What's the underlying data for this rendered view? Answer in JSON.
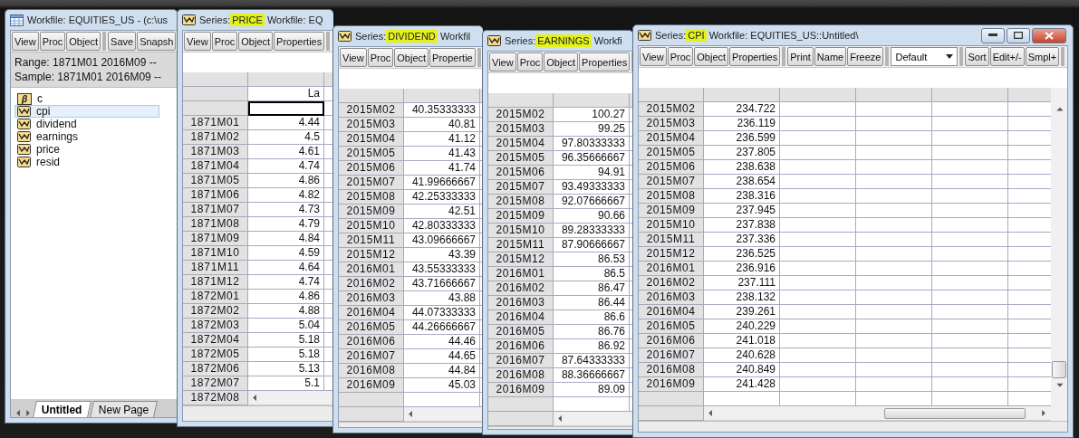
{
  "workfile_window": {
    "title": "Workfile: EQUITIES_US - (c:\\us",
    "toolbar": [
      [
        {
          "label": "View",
          "kind": "button"
        },
        {
          "label": "Proc",
          "kind": "button"
        },
        {
          "label": "Object",
          "kind": "button"
        }
      ],
      [
        {
          "label": "Save",
          "kind": "button"
        },
        {
          "label": "Snapsh",
          "kind": "button"
        }
      ]
    ],
    "range": "Range:  1871M01 2016M09  --",
    "sample": "Sample: 1871M01 2016M09  --",
    "objects": [
      {
        "name": "c",
        "kind": "coefficient",
        "glyph": "β",
        "selected": false
      },
      {
        "name": "cpi",
        "kind": "series",
        "selected": true
      },
      {
        "name": "dividend",
        "kind": "series",
        "selected": false
      },
      {
        "name": "earnings",
        "kind": "series",
        "selected": false
      },
      {
        "name": "price",
        "kind": "series",
        "selected": false
      },
      {
        "name": "resid",
        "kind": "series",
        "selected": false
      }
    ],
    "page_tabs": [
      {
        "label": "Untitled",
        "selected": true
      },
      {
        "label": "New Page",
        "selected": false
      }
    ]
  },
  "series_windows": [
    {
      "prefix": "Series:",
      "name": "PRICE",
      "highlighted": true,
      "suffix": "Workfile: EQ",
      "edit_row": true,
      "column_label": "La",
      "scroll_row_label": "1872M08",
      "toolbar": [
        [
          {
            "label": "View",
            "kind": "button"
          },
          {
            "label": "Proc",
            "kind": "button"
          },
          {
            "label": "Object",
            "kind": "button"
          },
          {
            "label": "Properties",
            "kind": "button"
          }
        ]
      ],
      "rows": [
        {
          "date": "1871M01",
          "value": "4.44"
        },
        {
          "date": "1871M02",
          "value": "4.5"
        },
        {
          "date": "1871M03",
          "value": "4.61"
        },
        {
          "date": "1871M04",
          "value": "4.74"
        },
        {
          "date": "1871M05",
          "value": "4.86"
        },
        {
          "date": "1871M06",
          "value": "4.82"
        },
        {
          "date": "1871M07",
          "value": "4.73"
        },
        {
          "date": "1871M08",
          "value": "4.79"
        },
        {
          "date": "1871M09",
          "value": "4.84"
        },
        {
          "date": "1871M10",
          "value": "4.59"
        },
        {
          "date": "1871M11",
          "value": "4.64"
        },
        {
          "date": "1871M12",
          "value": "4.74"
        },
        {
          "date": "1872M01",
          "value": "4.86"
        },
        {
          "date": "1872M02",
          "value": "4.88"
        },
        {
          "date": "1872M03",
          "value": "5.04"
        },
        {
          "date": "1872M04",
          "value": "5.18"
        },
        {
          "date": "1872M05",
          "value": "5.18"
        },
        {
          "date": "1872M06",
          "value": "5.13"
        },
        {
          "date": "1872M07",
          "value": "5.1"
        }
      ]
    },
    {
      "prefix": "Series:",
      "name": "DIVIDEND",
      "highlighted": true,
      "suffix": "Workfil",
      "edit_row": false,
      "toolbar": [
        [
          {
            "label": "View",
            "kind": "button"
          },
          {
            "label": "Proc",
            "kind": "button"
          },
          {
            "label": "Object",
            "kind": "button"
          },
          {
            "label": "Propertie",
            "kind": "button"
          }
        ]
      ],
      "rows": [
        {
          "date": "2015M02",
          "value": "40.35333333"
        },
        {
          "date": "2015M03",
          "value": "40.81"
        },
        {
          "date": "2015M04",
          "value": "41.12"
        },
        {
          "date": "2015M05",
          "value": "41.43"
        },
        {
          "date": "2015M06",
          "value": "41.74"
        },
        {
          "date": "2015M07",
          "value": "41.99666667"
        },
        {
          "date": "2015M08",
          "value": "42.25333333"
        },
        {
          "date": "2015M09",
          "value": "42.51"
        },
        {
          "date": "2015M10",
          "value": "42.80333333"
        },
        {
          "date": "2015M11",
          "value": "43.09666667"
        },
        {
          "date": "2015M12",
          "value": "43.39"
        },
        {
          "date": "2016M01",
          "value": "43.55333333"
        },
        {
          "date": "2016M02",
          "value": "43.71666667"
        },
        {
          "date": "2016M03",
          "value": "43.88"
        },
        {
          "date": "2016M04",
          "value": "44.07333333"
        },
        {
          "date": "2016M05",
          "value": "44.26666667"
        },
        {
          "date": "2016M06",
          "value": "44.46"
        },
        {
          "date": "2016M07",
          "value": "44.65"
        },
        {
          "date": "2016M08",
          "value": "44.84"
        },
        {
          "date": "2016M09",
          "value": "45.03"
        }
      ]
    },
    {
      "prefix": "Series:",
      "name": "EARNINGS",
      "highlighted": true,
      "suffix": "Workfi",
      "edit_row": false,
      "toolbar": [
        [
          {
            "label": "View",
            "kind": "button"
          },
          {
            "label": "Proc",
            "kind": "button"
          },
          {
            "label": "Object",
            "kind": "button"
          },
          {
            "label": "Properties",
            "kind": "button"
          }
        ]
      ],
      "rows": [
        {
          "date": "2015M02",
          "value": "100.27"
        },
        {
          "date": "2015M03",
          "value": "99.25"
        },
        {
          "date": "2015M04",
          "value": "97.80333333"
        },
        {
          "date": "2015M05",
          "value": "96.35666667"
        },
        {
          "date": "2015M06",
          "value": "94.91"
        },
        {
          "date": "2015M07",
          "value": "93.49333333"
        },
        {
          "date": "2015M08",
          "value": "92.07666667"
        },
        {
          "date": "2015M09",
          "value": "90.66"
        },
        {
          "date": "2015M10",
          "value": "89.28333333"
        },
        {
          "date": "2015M11",
          "value": "87.90666667"
        },
        {
          "date": "2015M12",
          "value": "86.53"
        },
        {
          "date": "2016M01",
          "value": "86.5"
        },
        {
          "date": "2016M02",
          "value": "86.47"
        },
        {
          "date": "2016M03",
          "value": "86.44"
        },
        {
          "date": "2016M04",
          "value": "86.6"
        },
        {
          "date": "2016M05",
          "value": "86.76"
        },
        {
          "date": "2016M06",
          "value": "86.92"
        },
        {
          "date": "2016M07",
          "value": "87.64333333"
        },
        {
          "date": "2016M08",
          "value": "88.36666667"
        },
        {
          "date": "2016M09",
          "value": "89.09"
        }
      ]
    },
    {
      "prefix": "Series:",
      "name": "CPI",
      "highlighted": true,
      "suffix": "Workfile: EQUITIES_US::Untitled\\",
      "edit_row": false,
      "toolbar": [
        [
          {
            "label": "View",
            "kind": "button"
          },
          {
            "label": "Proc",
            "kind": "button"
          },
          {
            "label": "Object",
            "kind": "button"
          },
          {
            "label": "Properties",
            "kind": "button"
          }
        ],
        [
          {
            "label": "Print",
            "kind": "button"
          },
          {
            "label": "Name",
            "kind": "button"
          },
          {
            "label": "Freeze",
            "kind": "button"
          }
        ],
        [
          {
            "label": "Default",
            "kind": "dropdown"
          }
        ],
        [
          {
            "label": "Sort",
            "kind": "button"
          },
          {
            "label": "Edit+/-",
            "kind": "button"
          },
          {
            "label": "Smpl+",
            "kind": "button"
          }
        ]
      ],
      "rows": [
        {
          "date": "2015M02",
          "value": "234.722"
        },
        {
          "date": "2015M03",
          "value": "236.119"
        },
        {
          "date": "2015M04",
          "value": "236.599"
        },
        {
          "date": "2015M05",
          "value": "237.805"
        },
        {
          "date": "2015M06",
          "value": "238.638"
        },
        {
          "date": "2015M07",
          "value": "238.654"
        },
        {
          "date": "2015M08",
          "value": "238.316"
        },
        {
          "date": "2015M09",
          "value": "237.945"
        },
        {
          "date": "2015M10",
          "value": "237.838"
        },
        {
          "date": "2015M11",
          "value": "237.336"
        },
        {
          "date": "2015M12",
          "value": "236.525"
        },
        {
          "date": "2016M01",
          "value": "236.916"
        },
        {
          "date": "2016M02",
          "value": "237.111"
        },
        {
          "date": "2016M03",
          "value": "238.132"
        },
        {
          "date": "2016M04",
          "value": "239.261"
        },
        {
          "date": "2016M05",
          "value": "240.229"
        },
        {
          "date": "2016M06",
          "value": "241.018"
        },
        {
          "date": "2016M07",
          "value": "240.628"
        },
        {
          "date": "2016M08",
          "value": "240.849"
        },
        {
          "date": "2016M09",
          "value": "241.428"
        }
      ]
    }
  ]
}
